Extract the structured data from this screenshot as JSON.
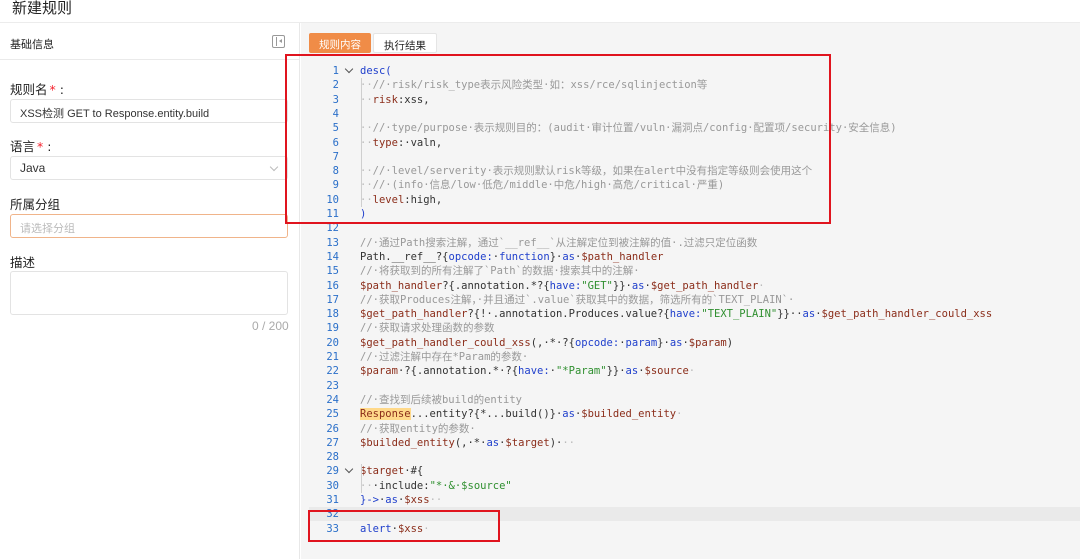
{
  "page": {
    "title": "新建规则"
  },
  "left": {
    "header": "基础信息",
    "rule_name_label": "规则名",
    "rule_name_required": "*",
    "rule_name_colon": ":",
    "rule_name_value": "XSS检测 GET to Response.entity.build",
    "language_label": "语言",
    "language_required": "*",
    "language_colon": ":",
    "language_value": "Java",
    "group_label": "所属分组",
    "group_placeholder": "请选择分组",
    "desc_label": "描述",
    "desc_counter": "0 / 200"
  },
  "tabs": [
    {
      "label": "规则内容",
      "active": true
    },
    {
      "label": "执行结果",
      "active": false
    }
  ],
  "code_lines": [
    {
      "n": "1",
      "fold": true,
      "segs": [
        [
          "k",
          "desc("
        ]
      ]
    },
    {
      "n": "2",
      "segs": [
        [
          "d",
          "··"
        ],
        [
          "c",
          "//·risk/risk_type表示风险类型·如：xss/rce/sqlinjection等"
        ]
      ]
    },
    {
      "n": "3",
      "segs": [
        [
          "d",
          "··"
        ],
        [
          "v",
          "risk"
        ],
        [
          "t",
          ":xss,"
        ]
      ]
    },
    {
      "n": "4",
      "segs": []
    },
    {
      "n": "5",
      "segs": [
        [
          "d",
          "··"
        ],
        [
          "c",
          "//·type/purpose·表示规则目的：(audit·审计位置/vuln·漏洞点/config·配置项/security·安全信息)"
        ]
      ]
    },
    {
      "n": "6",
      "segs": [
        [
          "d",
          "··"
        ],
        [
          "v",
          "type"
        ],
        [
          "t",
          ":·valn,"
        ]
      ]
    },
    {
      "n": "7",
      "segs": []
    },
    {
      "n": "8",
      "segs": [
        [
          "d",
          "··"
        ],
        [
          "c",
          "//·level/serverity·表示规则默认risk等级，如果在alert中没有指定等级则会使用这个"
        ]
      ]
    },
    {
      "n": "9",
      "segs": [
        [
          "d",
          "··"
        ],
        [
          "c",
          "//·(info·信息/low·低危/middle·中危/high·高危/critical·严重)"
        ]
      ]
    },
    {
      "n": "10",
      "segs": [
        [
          "d",
          "··"
        ],
        [
          "v",
          "level"
        ],
        [
          "t",
          ":high,"
        ]
      ]
    },
    {
      "n": "11",
      "segs": [
        [
          "k",
          ")"
        ]
      ]
    },
    {
      "n": "12",
      "segs": []
    },
    {
      "n": "13",
      "segs": [
        [
          "c",
          "//·通过Path搜索注解，通过`__ref__`从注解定位到被注解的值·.过滤只定位函数"
        ]
      ]
    },
    {
      "n": "14",
      "segs": [
        [
          "t",
          "Path.__ref__?{"
        ],
        [
          "k",
          "opcode:"
        ],
        [
          "t",
          "·"
        ],
        [
          "k",
          "function"
        ],
        [
          "t",
          "}·"
        ],
        [
          "k",
          "as"
        ],
        [
          "t",
          "·"
        ],
        [
          "v",
          "$path_handler"
        ]
      ]
    },
    {
      "n": "15",
      "segs": [
        [
          "c",
          "//·将获取到的所有注解了`Path`的数据·搜索其中的注解·"
        ]
      ]
    },
    {
      "n": "16",
      "segs": [
        [
          "v",
          "$path_handler"
        ],
        [
          "t",
          "?{.annotation.*?{"
        ],
        [
          "k",
          "have:"
        ],
        [
          "s",
          "\"GET\""
        ],
        [
          "t",
          "}}·"
        ],
        [
          "k",
          "as"
        ],
        [
          "t",
          "·"
        ],
        [
          "v",
          "$get_path_handler"
        ],
        [
          "d",
          "·"
        ]
      ]
    },
    {
      "n": "17",
      "segs": [
        [
          "c",
          "//·获取Produces注解，·并且通过`.value`获取其中的数据，筛选所有的`TEXT_PLAIN`·"
        ]
      ]
    },
    {
      "n": "18",
      "segs": [
        [
          "v",
          "$get_path_handler"
        ],
        [
          "t",
          "?{!·.annotation.Produces.value?{"
        ],
        [
          "k",
          "have:"
        ],
        [
          "s",
          "\"TEXT_PLAIN\""
        ],
        [
          "t",
          "}}··"
        ],
        [
          "k",
          "as"
        ],
        [
          "t",
          "·"
        ],
        [
          "v",
          "$get_path_handler_could_xss"
        ]
      ]
    },
    {
      "n": "19",
      "segs": [
        [
          "c",
          "//·获取请求处理函数的参数"
        ]
      ]
    },
    {
      "n": "20",
      "segs": [
        [
          "v",
          "$get_path_handler_could_xss"
        ],
        [
          "t",
          "(,·*·?{"
        ],
        [
          "k",
          "opcode:"
        ],
        [
          "t",
          "·"
        ],
        [
          "k",
          "param"
        ],
        [
          "t",
          "}·"
        ],
        [
          "k",
          "as"
        ],
        [
          "t",
          "·"
        ],
        [
          "v",
          "$param"
        ],
        [
          "t",
          ")"
        ]
      ]
    },
    {
      "n": "21",
      "segs": [
        [
          "c",
          "//·过滤注解中存在*Param的参数·"
        ]
      ]
    },
    {
      "n": "22",
      "segs": [
        [
          "v",
          "$param"
        ],
        [
          "t",
          "·?{.annotation.*·?{"
        ],
        [
          "k",
          "have:"
        ],
        [
          "t",
          "·"
        ],
        [
          "s",
          "\"*Param\""
        ],
        [
          "t",
          "}}·"
        ],
        [
          "k",
          "as"
        ],
        [
          "t",
          "·"
        ],
        [
          "v",
          "$source"
        ],
        [
          "d",
          "·"
        ]
      ]
    },
    {
      "n": "23",
      "segs": []
    },
    {
      "n": "24",
      "segs": [
        [
          "c",
          "//·查找到后续被build的entity"
        ]
      ]
    },
    {
      "n": "25",
      "segs": [
        [
          "h",
          "Response"
        ],
        [
          "t",
          "...entity?{*...build()}·"
        ],
        [
          "k",
          "as"
        ],
        [
          "t",
          "·"
        ],
        [
          "v",
          "$builded_entity"
        ],
        [
          "d",
          "·"
        ]
      ]
    },
    {
      "n": "26",
      "segs": [
        [
          "c",
          "//·获取entity的参数·"
        ]
      ]
    },
    {
      "n": "27",
      "segs": [
        [
          "v",
          "$builded_entity"
        ],
        [
          "t",
          "(,·*·"
        ],
        [
          "k",
          "as"
        ],
        [
          "t",
          "·"
        ],
        [
          "v",
          "$target"
        ],
        [
          "t",
          ")·"
        ],
        [
          "d",
          "··"
        ]
      ]
    },
    {
      "n": "28",
      "segs": []
    },
    {
      "n": "29",
      "fold": true,
      "segs": [
        [
          "v",
          "$target"
        ],
        [
          "t",
          "·#{"
        ]
      ]
    },
    {
      "n": "30",
      "segs": [
        [
          "d",
          "··"
        ],
        [
          "t",
          "·include:"
        ],
        [
          "s",
          "\"*·&·$source\""
        ]
      ]
    },
    {
      "n": "31",
      "segs": [
        [
          "k",
          "}->"
        ],
        [
          "t",
          "·"
        ],
        [
          "k",
          "as"
        ],
        [
          "t",
          "·"
        ],
        [
          "v",
          "$xss"
        ],
        [
          "d",
          "··"
        ]
      ]
    },
    {
      "n": "32",
      "segs": []
    },
    {
      "n": "33",
      "segs": [
        [
          "k",
          "alert"
        ],
        [
          "t",
          "·"
        ],
        [
          "v",
          "$xss"
        ],
        [
          "d",
          "·"
        ]
      ]
    }
  ],
  "colors": {
    "accent": "#f08c47",
    "highlight_box": "#e0141e",
    "line_number": "#2a6fc9"
  }
}
